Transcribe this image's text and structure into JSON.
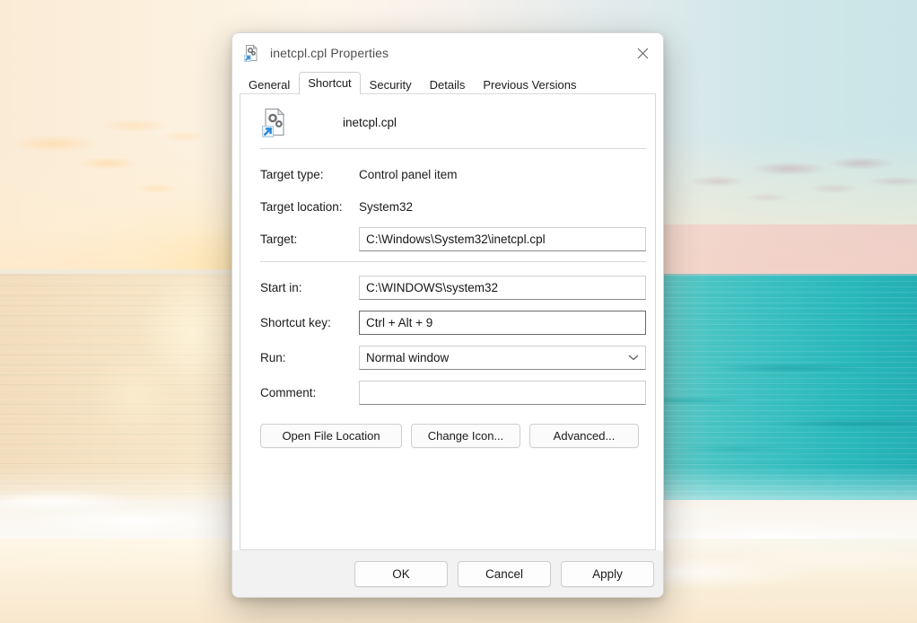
{
  "window": {
    "title": "inetcpl.cpl Properties",
    "title_icon": "control-panel-shortcut-icon",
    "close_icon": "close-icon"
  },
  "tabs": [
    {
      "label": "General",
      "active": false
    },
    {
      "label": "Shortcut",
      "active": true
    },
    {
      "label": "Security",
      "active": false
    },
    {
      "label": "Details",
      "active": false
    },
    {
      "label": "Previous Versions",
      "active": false
    }
  ],
  "header": {
    "icon": "control-panel-shortcut-icon",
    "name": "inetcpl.cpl"
  },
  "fields": {
    "target_type_label": "Target type:",
    "target_type_value": "Control panel item",
    "target_location_label": "Target location:",
    "target_location_value": "System32",
    "target_label": "Target:",
    "target_value": "C:\\Windows\\System32\\inetcpl.cpl",
    "start_in_label": "Start in:",
    "start_in_value": "C:\\WINDOWS\\system32",
    "shortcut_key_label": "Shortcut key:",
    "shortcut_key_value": "Ctrl + Alt + 9",
    "run_label": "Run:",
    "run_value": "Normal window",
    "run_chevron": "chevron-down-icon",
    "comment_label": "Comment:",
    "comment_value": ""
  },
  "action_buttons": {
    "open_file_location": "Open File Location",
    "change_icon": "Change Icon...",
    "advanced": "Advanced..."
  },
  "footer_buttons": {
    "ok": "OK",
    "cancel": "Cancel",
    "apply": "Apply"
  },
  "colors": {
    "accent_blue": "#2b87d4",
    "dialog_bg": "#ffffff",
    "footer_bg": "#f2f2f2",
    "text": "#1b1b1b",
    "title_text": "#4f4f4f",
    "border": "#cfcfcf"
  }
}
